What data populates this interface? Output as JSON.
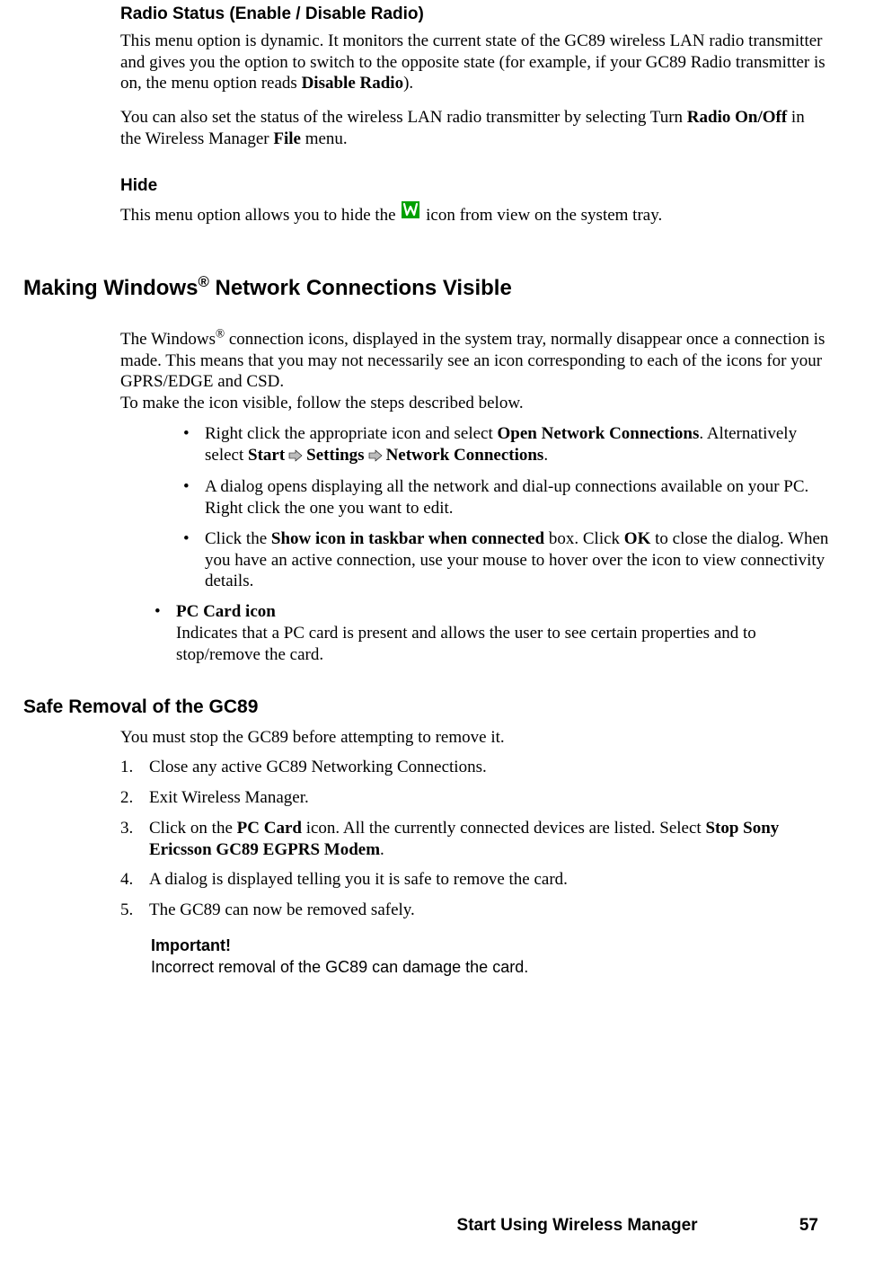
{
  "section1": {
    "title": "Radio Status (Enable / Disable Radio)",
    "p1_a": "This menu option is dynamic. It monitors the current state of the GC89 wireless LAN radio transmitter and gives you the option to switch to the opposite state (for example, if your GC89 Radio transmitter is on, the menu option reads ",
    "p1_bold": "Disable Radio",
    "p1_b": ").",
    "p2_a": "You can also set the status of the wireless LAN radio transmitter by selecting Turn ",
    "p2_b1": "Radio On/Off",
    "p2_c": " in the Wireless Manager ",
    "p2_b2": "File",
    "p2_d": " menu."
  },
  "section2": {
    "title": "Hide",
    "p1_a": "This menu option allows you to hide the ",
    "p1_b": " icon from view on the system tray."
  },
  "heading2": {
    "a": "Making Windows",
    "sup": "®",
    "b": " Network Connections Visible"
  },
  "section3": {
    "p1_a": "The Windows",
    "p1_sup": "®",
    "p1_b": " connection icons, displayed in the system tray, normally disappear once a connection is made. This means that you may not necessarily see an icon corresponding to each of the icons for your GPRS/EDGE and CSD.",
    "p1_c": "To make the icon visible, follow the steps described below.",
    "bullets2": [
      {
        "a": "Right click the appropriate icon and select ",
        "b1": "Open Network Connections",
        "b": ". Alternatively select ",
        "b2": "Start",
        "c": " ",
        "b3": "Settings",
        "d": " ",
        "b4": "Network Connections",
        "e": "."
      },
      {
        "a": "A dialog opens displaying all the network and dial-up connections available on your PC. Right click the one you want to edit."
      },
      {
        "a": "Click the ",
        "b1": "Show icon in taskbar when connected",
        "b": " box. Click ",
        "b2": "OK",
        "c": " to close the dialog. When you have an active connection, use your mouse to hover over the icon to view connectivity details."
      }
    ],
    "bullet1": {
      "title": "PC Card icon",
      "body": "Indicates that a PC card is present and allows the user to see certain properties and to stop/remove the card."
    }
  },
  "section4": {
    "title": "Safe Removal of the GC89",
    "p1": "You must stop the GC89 before attempting to remove it.",
    "steps": [
      {
        "a": "Close any active GC89 Networking Connections."
      },
      {
        "a": "Exit Wireless Manager."
      },
      {
        "a": "Click on the ",
        "b1": "PC Card",
        "b": " icon. All the currently connected devices are listed. Select ",
        "b2": "Stop Sony Ericsson GC89 EGPRS Modem",
        "c": "."
      },
      {
        "a": "A dialog is displayed telling you it is safe to remove the card."
      },
      {
        "a": "The GC89 can now be removed safely."
      }
    ],
    "important_title": "Important!",
    "important_body": "Incorrect removal of the GC89 can damage the card."
  },
  "footer": {
    "title": "Start Using Wireless Manager",
    "page": "57"
  },
  "icons": {
    "w_icon": "wireless-manager-icon",
    "arrow": "breadcrumb-arrow-icon"
  }
}
